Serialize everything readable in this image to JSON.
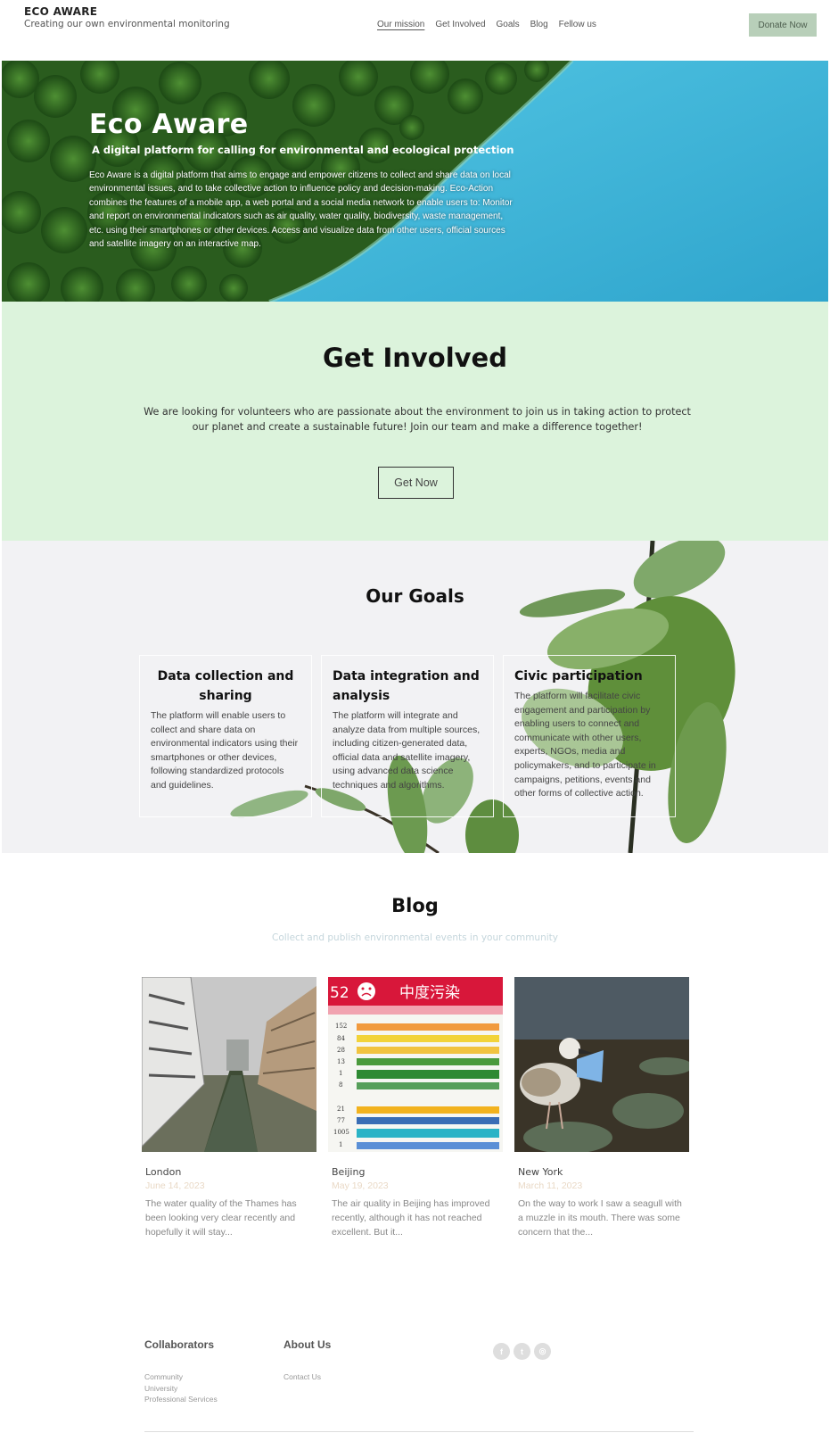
{
  "header": {
    "brand_title": "ECO AWARE",
    "brand_subtitle": "Creating our own environmental monitoring",
    "nav": [
      "Our mission",
      "Get Involved",
      "Goals",
      "Blog",
      "Fellow us"
    ],
    "donate_label": "Donate Now"
  },
  "hero": {
    "title": "Eco Aware",
    "subtitle": "A digital platform for calling for environmental and ecological protection",
    "body": "Eco Aware is a digital platform that aims to engage and empower citizens to collect and share data on local environmental issues, and to take collective action to influence policy and decision-making. Eco-Action combines the features of a mobile app, a web portal and a social media network to enable users to: Monitor and report on environmental indicators such as air quality, water quality, biodiversity, waste management, etc. using their smartphones or other devices. Access and visualize data from other users, official sources and satellite imagery on an interactive map."
  },
  "involved": {
    "title": "Get Involved",
    "body": "We are looking for volunteers who are passionate about the environment to join us in taking action to protect our planet and create a sustainable future! Join our team and make a difference together!",
    "button": "Get Now"
  },
  "goals": {
    "title": "Our Goals",
    "cards": [
      {
        "title": "Data collection and sharing",
        "body": "The platform will enable users to collect and share data on environmental indicators using their smartphones or other devices, following standardized protocols and guidelines."
      },
      {
        "title": "Data integration and analysis",
        "body": "The platform will integrate and analyze data from multiple sources, including citizen-generated data, official data and satellite imagery, using advanced data science techniques and algorithms."
      },
      {
        "title": "Civic participation",
        "body": "The platform will facilitate civic engagement and participation by enabling users to connect and communicate with other users, experts, NGOs, media and policymakers, and to participate in campaigns, petitions, events and other forms of collective action."
      }
    ]
  },
  "blog": {
    "title": "Blog",
    "subtitle": "Collect and publish environmental events in your community",
    "posts": [
      {
        "city": "London",
        "date": "June 14, 2023",
        "excerpt": "The water quality of the Thames has been looking very clear recently and hopefully it will stay..."
      },
      {
        "city": "Beijing",
        "date": "May 19, 2023",
        "excerpt": "The air quality in Beijing has improved recently, although it has not reached excellent. But it..."
      },
      {
        "city": "New York",
        "date": "March 11, 2023",
        "excerpt": "On the way to work I saw a seagull with a muzzle in its mouth. There was some concern that the..."
      }
    ],
    "beijing_sign": {
      "aqi": "52",
      "level": "中度污染",
      "rows": [
        "152",
        "84",
        "28",
        "13",
        "1",
        "8",
        "21",
        "77",
        "1005",
        "1"
      ]
    }
  },
  "footer": {
    "collaborators_title": "Collaborators",
    "collaborators": [
      "Community",
      "University",
      "Professional Services"
    ],
    "about_title": "About Us",
    "about_links": [
      "Contact Us"
    ],
    "social_icons": [
      "facebook-icon",
      "twitter-icon",
      "instagram-icon"
    ]
  },
  "colors": {
    "donate_bg": "#b8cfb9",
    "involved_bg": "#dcf3dc",
    "goals_bg": "#f2f2f4",
    "lake": "#3fb6d8",
    "forest": "#2f6b22"
  }
}
